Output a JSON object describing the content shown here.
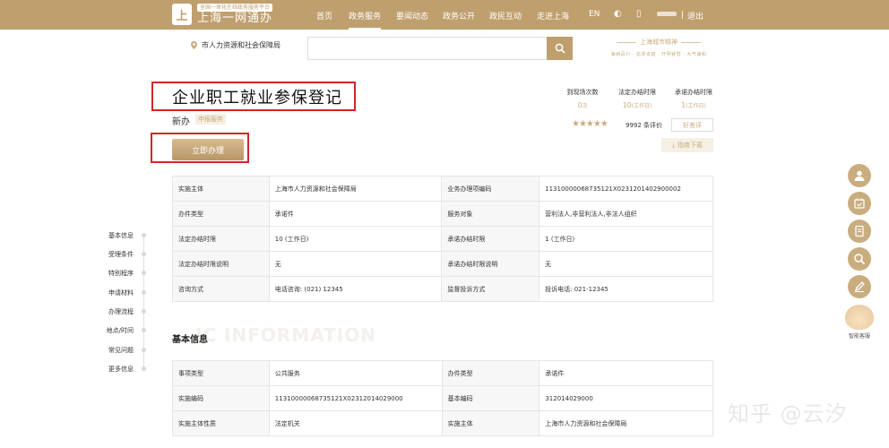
{
  "logo": {
    "mark": "上",
    "subtitle": "全国一体化在线政务服务平台",
    "title": "上海一网通办"
  },
  "nav": {
    "items": [
      "首页",
      "政务服务",
      "要闻动态",
      "政务公开",
      "政民互动",
      "走进上海"
    ],
    "lang": "EN",
    "logout": "退出"
  },
  "search": {
    "department": "市人力资源和社会保障局",
    "placeholder": ""
  },
  "city_brand": {
    "title": "上海城市精神",
    "slogan": "海纳百川 · 追求卓越 · 开明睿智 · 大气谦和"
  },
  "service": {
    "title": "企业职工就业参保登记",
    "subtitle": "新办",
    "badge": "申报服务",
    "apply_button": "立即办理"
  },
  "stats": [
    {
      "label": "到现场次数",
      "value": "0",
      "unit": "次"
    },
    {
      "label": "法定办结时限",
      "value": "10",
      "unit": "(工作日)"
    },
    {
      "label": "承诺办结时限",
      "value": "1",
      "unit": "(工作日)"
    }
  ],
  "rating": {
    "stars": 5,
    "count_text": "9992 条评价",
    "review_button": "好差评",
    "guide_button": "指南下载"
  },
  "table1": [
    [
      "实施主体",
      "上海市人力资源和社会保障局",
      "业务办理项编码",
      "113100000687351​21X02312014029000​02"
    ],
    [
      "办件类型",
      "承诺件",
      "服务对象",
      "营利法人,非营利法人,非法人组织"
    ],
    [
      "法定办结时限",
      "10 (工作日)",
      "承诺办结时限",
      "1 (工作日)"
    ],
    [
      "法定办结时限说明",
      "无",
      "承诺办结时限说明",
      "无"
    ],
    [
      "咨询方式",
      "电话咨询: (021) 12345",
      "监督投诉方式",
      "投诉电话: 021-12345"
    ]
  ],
  "section": {
    "title": "基本信息",
    "bg_text": "IC INFORMATION"
  },
  "table2": [
    [
      "事项类型",
      "公共服务",
      "办件类型",
      "承诺件"
    ],
    [
      "实施编码",
      "11310000068735121X02312014029000",
      "基本编码",
      "312014029000"
    ],
    [
      "实施主体性质",
      "法定机关",
      "实施主体",
      "上海市人力资源和社会保障局"
    ]
  ],
  "sidenav": [
    "基本信息",
    "受理条件",
    "特别程序",
    "申请材料",
    "办理流程",
    "地点/时间",
    "常见问题",
    "更多信息"
  ],
  "robot_label": "智能客服",
  "watermark": "知乎 @云汐",
  "colors": {
    "brand": "#bf9f6e",
    "accent_red": "#d0262a"
  }
}
